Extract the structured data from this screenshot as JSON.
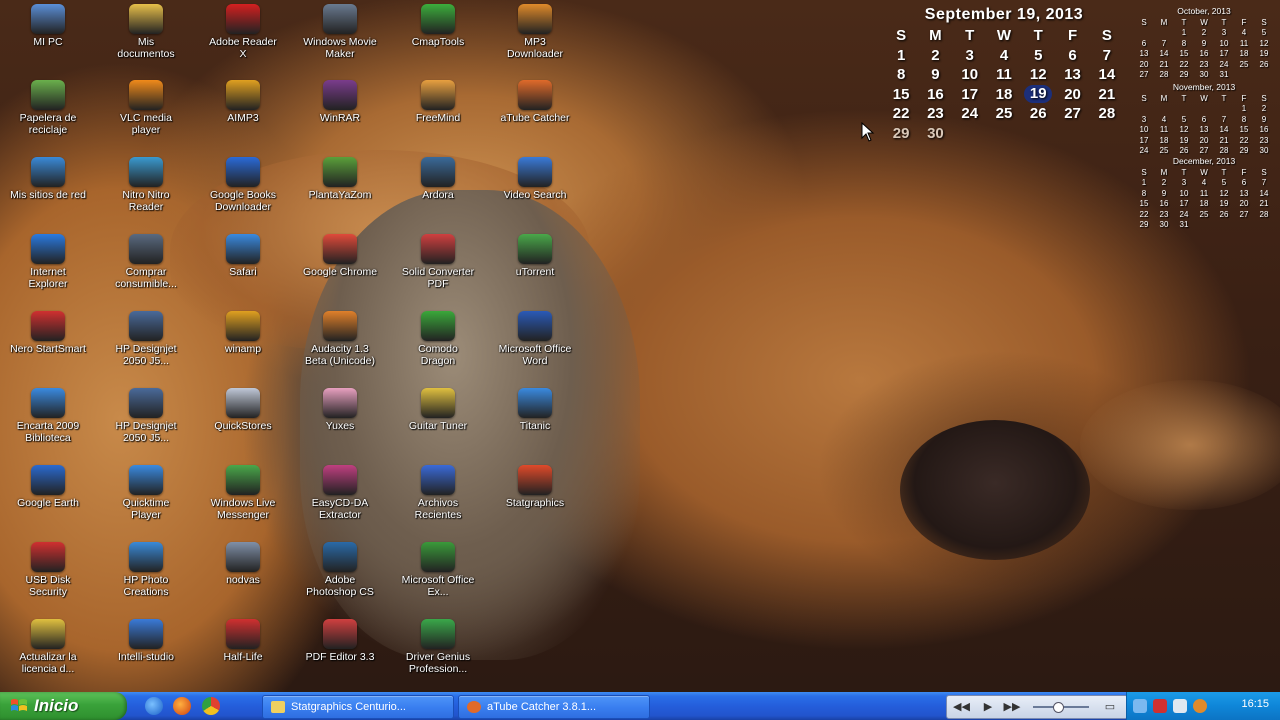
{
  "desktop": {
    "icons": [
      {
        "label": "MI PC",
        "icon": "my-computer-icon",
        "color": "#5b8fd8"
      },
      {
        "label": "Mis documentos",
        "icon": "my-documents-icon",
        "color": "#e8c04a"
      },
      {
        "label": "Adobe Reader X",
        "icon": "adobe-reader-icon",
        "color": "#d42020"
      },
      {
        "label": "Windows Movie Maker",
        "icon": "movie-maker-icon",
        "color": "#6a7a90"
      },
      {
        "label": "CmapTools",
        "icon": "cmaptools-icon",
        "color": "#3cae3c"
      },
      {
        "label": "MP3 Downloader",
        "icon": "mp3-downloader-icon",
        "color": "#e08a2a"
      },
      {
        "label": "Papelera de reciclaje",
        "icon": "recycle-bin-icon",
        "color": "#6ab04c"
      },
      {
        "label": "VLC media player",
        "icon": "vlc-icon",
        "color": "#f08a1a"
      },
      {
        "label": "AIMP3",
        "icon": "aimp-icon",
        "color": "#e0a020"
      },
      {
        "label": "WinRAR",
        "icon": "winrar-icon",
        "color": "#7a3c8c"
      },
      {
        "label": "FreeMind",
        "icon": "freemind-icon",
        "color": "#e8a040"
      },
      {
        "label": "aTube Catcher",
        "icon": "atube-catcher-icon",
        "color": "#e06a2a"
      },
      {
        "label": "Mis sitios de red",
        "icon": "network-places-icon",
        "color": "#3a8ad8"
      },
      {
        "label": "Nitro Nitro Reader",
        "icon": "nitro-icon",
        "color": "#3a9ad0"
      },
      {
        "label": "Google Books Downloader",
        "icon": "google-books-icon",
        "color": "#2a6ad8"
      },
      {
        "label": "PlantaYaZom",
        "icon": "plant-icon",
        "color": "#5aa03a"
      },
      {
        "label": "Ardora",
        "icon": "ardora-icon",
        "color": "#3a6a9a"
      },
      {
        "label": "Video Search",
        "icon": "video-search-icon",
        "color": "#3a7ad8"
      },
      {
        "label": "Internet Explorer",
        "icon": "internet-explorer-icon",
        "color": "#2a7ae0"
      },
      {
        "label": "Comprar consumible...",
        "icon": "printer-icon",
        "color": "#5a6a80"
      },
      {
        "label": "Safari",
        "icon": "safari-icon",
        "color": "#3a8ae0"
      },
      {
        "label": "Google Chrome",
        "icon": "chrome-icon",
        "color": "#e04a3a"
      },
      {
        "label": "Solid Converter PDF",
        "icon": "solid-converter-icon",
        "color": "#d04040"
      },
      {
        "label": "uTorrent",
        "icon": "utorrent-icon",
        "color": "#4aa84a"
      },
      {
        "label": "Nero StartSmart",
        "icon": "nero-icon",
        "color": "#d03030"
      },
      {
        "label": "HP Designjet 2050 J5...",
        "icon": "hp-designjet-icon",
        "color": "#4a6a9a"
      },
      {
        "label": "winamp",
        "icon": "winamp-icon",
        "color": "#e0a020"
      },
      {
        "label": "Audacity 1.3 Beta (Unicode)",
        "icon": "audacity-icon",
        "color": "#e0802a"
      },
      {
        "label": "Comodo Dragon",
        "icon": "dragon-icon",
        "color": "#3aa83a"
      },
      {
        "label": "Microsoft Office Word",
        "icon": "word-icon",
        "color": "#2a5ab8"
      },
      {
        "label": "Encarta 2009 Biblioteca",
        "icon": "encarta-icon",
        "color": "#3a8ae0"
      },
      {
        "label": "HP Designjet 2050 J5...",
        "icon": "hp-designjet-icon",
        "color": "#4a6a9a"
      },
      {
        "label": "QuickStores",
        "icon": "quickstores-icon",
        "color": "#c0c8d8"
      },
      {
        "label": "Yuxes",
        "icon": "yuxes-icon",
        "color": "#e8a0c0"
      },
      {
        "label": "Guitar Tuner",
        "icon": "guitar-tuner-icon",
        "color": "#e0c040"
      },
      {
        "label": "Titanic",
        "icon": "titanic-icon",
        "color": "#3a8ae0"
      },
      {
        "label": "Google Earth",
        "icon": "google-earth-icon",
        "color": "#2a6ad0"
      },
      {
        "label": "Quicktime Player",
        "icon": "quicktime-icon",
        "color": "#3a8ae0"
      },
      {
        "label": "Windows Live Messenger",
        "icon": "messenger-icon",
        "color": "#4aa84a"
      },
      {
        "label": "EasyCD-DA Extractor",
        "icon": "cd-extractor-icon",
        "color": "#c04080"
      },
      {
        "label": "Archivos Recientes",
        "icon": "recent-files-icon",
        "color": "#3a6ad8"
      },
      {
        "label": "Statgraphics",
        "icon": "statgraphics-icon",
        "color": "#e04a2a"
      },
      {
        "label": "USB Disk Security",
        "icon": "usb-security-icon",
        "color": "#d03030"
      },
      {
        "label": "HP Photo Creations",
        "icon": "hp-photo-icon",
        "color": "#3a8ad8"
      },
      {
        "label": "nodvas",
        "icon": "nodvas-icon",
        "color": "#8090a8"
      },
      {
        "label": "Adobe Photoshop CS",
        "icon": "photoshop-icon",
        "color": "#2a6aa8"
      },
      {
        "label": "Microsoft Office Ex...",
        "icon": "excel-icon",
        "color": "#3a9a3a"
      },
      {
        "label": "",
        "icon": "",
        "color": ""
      },
      {
        "label": "Actualizar la licencia d...",
        "icon": "license-update-icon",
        "color": "#e0c040"
      },
      {
        "label": "Intelli-studio",
        "icon": "intelli-studio-icon",
        "color": "#3a7ad8"
      },
      {
        "label": "Half-Life",
        "icon": "half-life-icon",
        "color": "#d03030"
      },
      {
        "label": "PDF Editor 3.3",
        "icon": "pdf-editor-icon",
        "color": "#d04040"
      },
      {
        "label": "Driver Genius Profession...",
        "icon": "driver-genius-icon",
        "color": "#3aa84a"
      },
      {
        "label": "",
        "icon": "",
        "color": ""
      }
    ]
  },
  "calendar": {
    "main": {
      "title": "September 19, 2013",
      "weekdays": [
        "S",
        "M",
        "T",
        "W",
        "T",
        "F",
        "S"
      ],
      "weeks": [
        [
          "1",
          "2",
          "3",
          "4",
          "5",
          "6",
          "7"
        ],
        [
          "8",
          "9",
          "10",
          "11",
          "12",
          "13",
          "14"
        ],
        [
          "15",
          "16",
          "17",
          "18",
          "19",
          "20",
          "21"
        ],
        [
          "22",
          "23",
          "24",
          "25",
          "26",
          "27",
          "28"
        ],
        [
          "29",
          "30",
          "",
          "",
          "",
          "",
          ""
        ]
      ],
      "today": "19"
    },
    "mini": [
      {
        "title": "October, 2013",
        "weekdays": [
          "S",
          "M",
          "T",
          "W",
          "T",
          "F",
          "S"
        ],
        "weeks": [
          [
            "",
            "",
            "1",
            "2",
            "3",
            "4",
            "5"
          ],
          [
            "6",
            "7",
            "8",
            "9",
            "10",
            "11",
            "12"
          ],
          [
            "13",
            "14",
            "15",
            "16",
            "17",
            "18",
            "19"
          ],
          [
            "20",
            "21",
            "22",
            "23",
            "24",
            "25",
            "26"
          ],
          [
            "27",
            "28",
            "29",
            "30",
            "31",
            "",
            ""
          ]
        ]
      },
      {
        "title": "November, 2013",
        "weekdays": [
          "S",
          "M",
          "T",
          "W",
          "T",
          "F",
          "S"
        ],
        "weeks": [
          [
            "",
            "",
            "",
            "",
            "",
            "1",
            "2"
          ],
          [
            "3",
            "4",
            "5",
            "6",
            "7",
            "8",
            "9"
          ],
          [
            "10",
            "11",
            "12",
            "13",
            "14",
            "15",
            "16"
          ],
          [
            "17",
            "18",
            "19",
            "20",
            "21",
            "22",
            "23"
          ],
          [
            "24",
            "25",
            "26",
            "27",
            "28",
            "29",
            "30"
          ]
        ]
      },
      {
        "title": "December, 2013",
        "weekdays": [
          "S",
          "M",
          "T",
          "W",
          "T",
          "F",
          "S"
        ],
        "weeks": [
          [
            "1",
            "2",
            "3",
            "4",
            "5",
            "6",
            "7"
          ],
          [
            "8",
            "9",
            "10",
            "11",
            "12",
            "13",
            "14"
          ],
          [
            "15",
            "16",
            "17",
            "18",
            "19",
            "20",
            "21"
          ],
          [
            "22",
            "23",
            "24",
            "25",
            "26",
            "27",
            "28"
          ],
          [
            "29",
            "30",
            "31",
            "",
            "",
            "",
            ""
          ]
        ]
      }
    ]
  },
  "taskbar": {
    "start_label": "Inicio",
    "quick_launch": [
      "ie-icon",
      "firefox-icon",
      "chrome-icon"
    ],
    "tasks": [
      {
        "label": "Statgraphics Centurio...",
        "icon": "folder-icon"
      },
      {
        "label": "aTube Catcher 3.8.1...",
        "icon": "atube-catcher-icon"
      }
    ],
    "clock": "16:15"
  }
}
